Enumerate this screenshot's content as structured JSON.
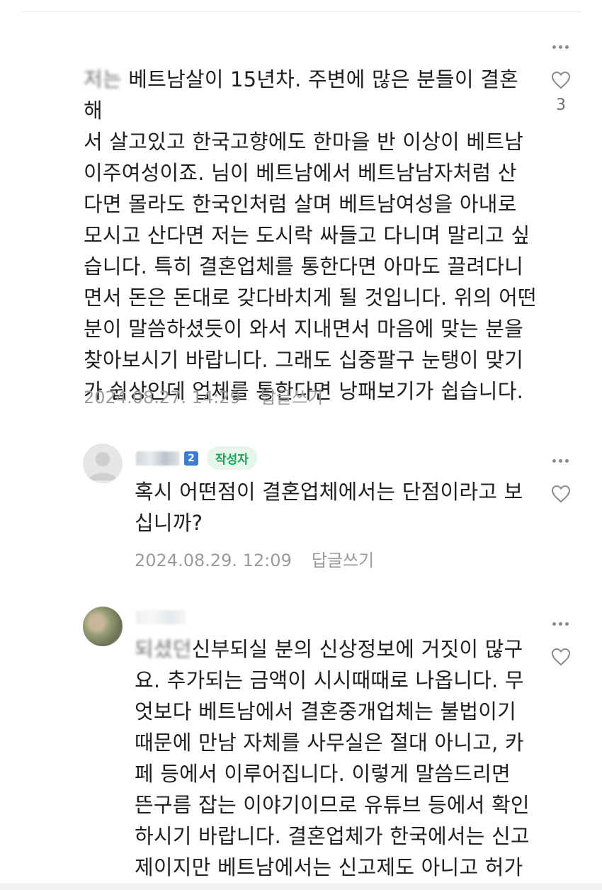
{
  "comments": [
    {
      "blurred_prefix": "저는",
      "text": " 베트남살이 15년차. 주변에 많은 분들이 결혼해서 살고있고 한국고향에도 한마을 반 이상이 베트남 이주여성이죠. 님이 베트남에서 베트남남자처럼 산다면 몰라도 한국인처럼 살며 베트남여성을 아내로 모시고 산다면 저는 도시락 싸들고 다니며 말리고 싶습니다. 특히 결혼업체를 통한다면 아마도 끌려다니면서 돈은 돈대로 갖다바치게 될 것입니다. 위의 어떤분이 말씀하셨듯이 와서 지내면서 마음에 맞는 분을 찾아보시기 바랍니다. 그래도 십중팔구 눈탱이 맞기가 쉽상인데 업체를 통한다면 낭패보기가 쉽습니다.",
      "lines": [
        "베트남살이 15년차. 주변에 많은 분들이 결혼해",
        "서 살고있고 한국고향에도 한마을 반 이상이 베트남",
        "이주여성이죠. 님이 베트남에서 베트남남자처럼 산",
        "다면 몰라도 한국인처럼 살며 베트남여성을 아내로",
        "모시고 산다면 저는 도시락 싸들고 다니며 말리고 싶",
        "습니다. 특히 결혼업체를 통한다면 아마도 끌려다니",
        "면서 돈은 돈대로 갖다바치게 될 것입니다. 위의 어떤",
        "분이 말씀하셨듯이 와서 지내면서 마음에 맞는 분을",
        "찾아보시기 바랍니다. 그래도 십중팔구 눈탱이 맞기",
        "가 쉽상인데 업체를 통한다면 낭패보기가 쉽습니다."
      ],
      "date": "2024.08.27. 14:29",
      "reply_label": "답글쓰기",
      "likes": "3"
    },
    {
      "level": "2",
      "author_badge": "작성자",
      "lines": [
        "혹시 어떤점이 결혼업체에서는 단점이라고 보",
        "십니까?"
      ],
      "date": "2024.08.29. 12:09",
      "reply_label": "답글쓰기"
    },
    {
      "blurred_prefix": "되셨던",
      "lines": [
        "신부되실 분의 신상정보에 거짓이 많구",
        "요. 추가되는 금액이 시시때때로 나옵니다. 무",
        "엇보다 베트남에서 결혼중개업체는 불법이기",
        "때문에 만남 자체를 사무실은 절대 아니고, 카",
        "페 등에서 이루어집니다. 이렇게 말씀드리면",
        "뜬구름 잡는 이야기이므로 유튜브 등에서 확인",
        "하시기 바랍니다. 결혼업체가 한국에서는 신고",
        "제이지만 베트남에서는 신고제도 아니고 허가"
      ]
    }
  ],
  "colors": {
    "author_badge_bg": "#e6f6eb",
    "author_badge_text": "#1aa05a",
    "level_badge": "#3a7bd5",
    "meta_text": "#9a9a9a"
  },
  "icons": {
    "like": "heart-outline-icon",
    "more": "more-vertical-dots-icon"
  }
}
